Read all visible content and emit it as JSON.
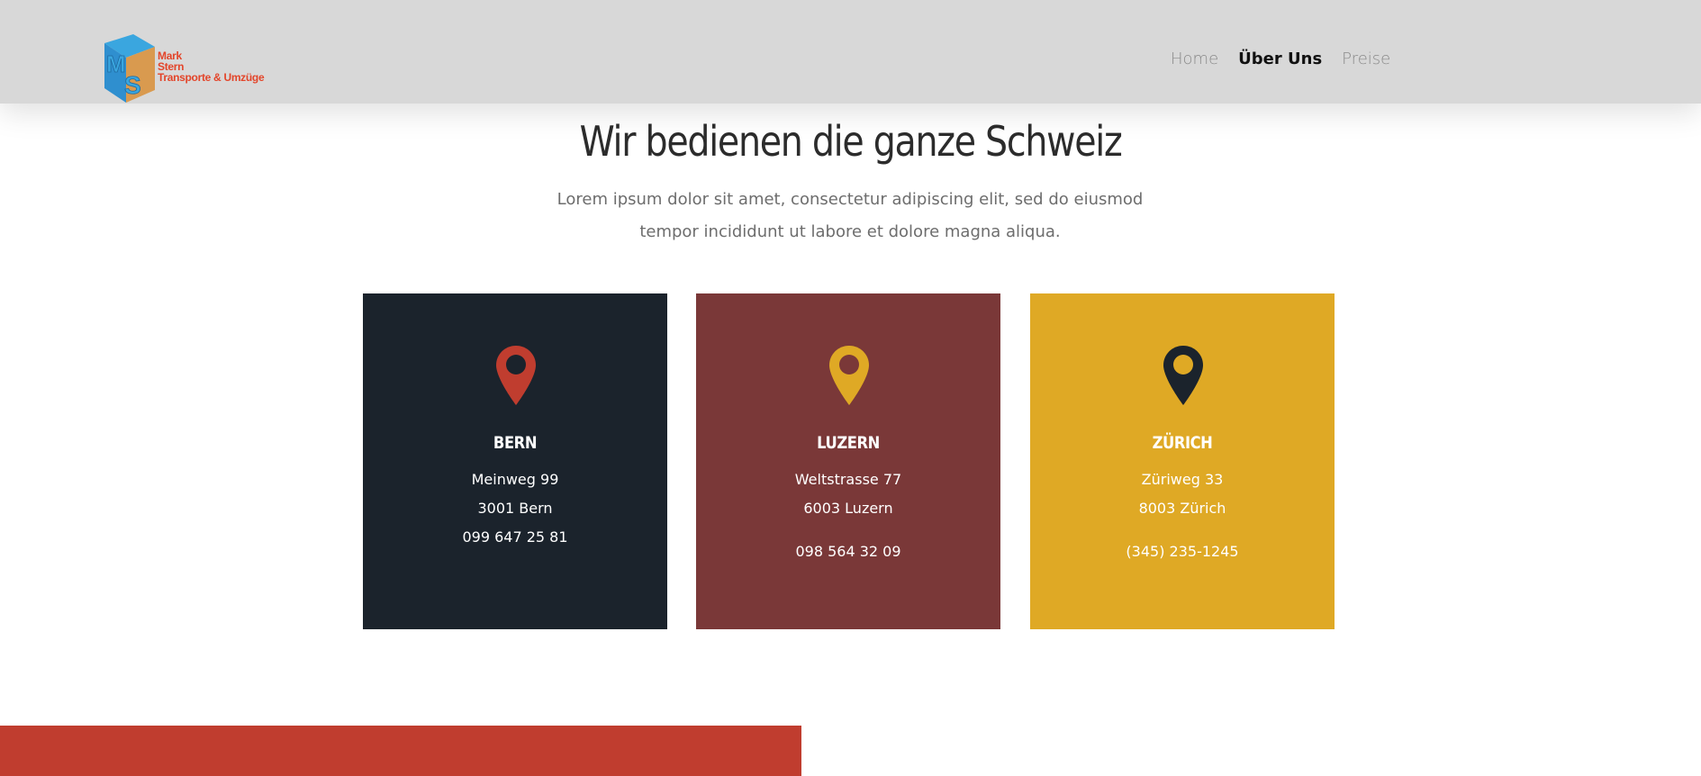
{
  "brand": {
    "logo_initials": "MS",
    "logo_line1": "Mark",
    "logo_line2": "Stern",
    "logo_line3": "Transporte & Umzüge"
  },
  "nav": {
    "items": [
      {
        "label": "Home",
        "active": false
      },
      {
        "label": "Über Uns",
        "active": true
      },
      {
        "label": "Preise",
        "active": false
      }
    ]
  },
  "section": {
    "title": "Wir bedienen die ganze Schweiz",
    "subtitle": "Lorem ipsum dolor sit amet, consectetur adipiscing elit, sed do eiusmod tempor incididunt ut labore et dolore magna aliqua."
  },
  "locations": [
    {
      "city": "BERN",
      "street": "Meinweg 99",
      "zip_city": "3001 Bern",
      "phone": "099 647 25 81",
      "bg_color": "#1b232c",
      "pin_color": "#c03d2f",
      "icon": "location-pin-icon"
    },
    {
      "city": "LUZERN",
      "street": "Weltstrasse 77",
      "zip_city": "6003 Luzern",
      "phone": "098 564 32 09",
      "bg_color": "#7a3838",
      "pin_color": "#dfa925",
      "icon": "location-pin-icon"
    },
    {
      "city": "ZÜRICH",
      "street": "Züriweg 33",
      "zip_city": "8003 Zürich",
      "phone": "(345) 235-1245",
      "bg_color": "#dfa925",
      "pin_color": "#1b232c",
      "icon": "location-pin-icon"
    }
  ],
  "colors": {
    "header_bg": "#d8d8d8",
    "accent_red": "#c03d2f",
    "accent_gold": "#dfa925",
    "dark_navy": "#1b232c",
    "maroon": "#7a3838"
  }
}
